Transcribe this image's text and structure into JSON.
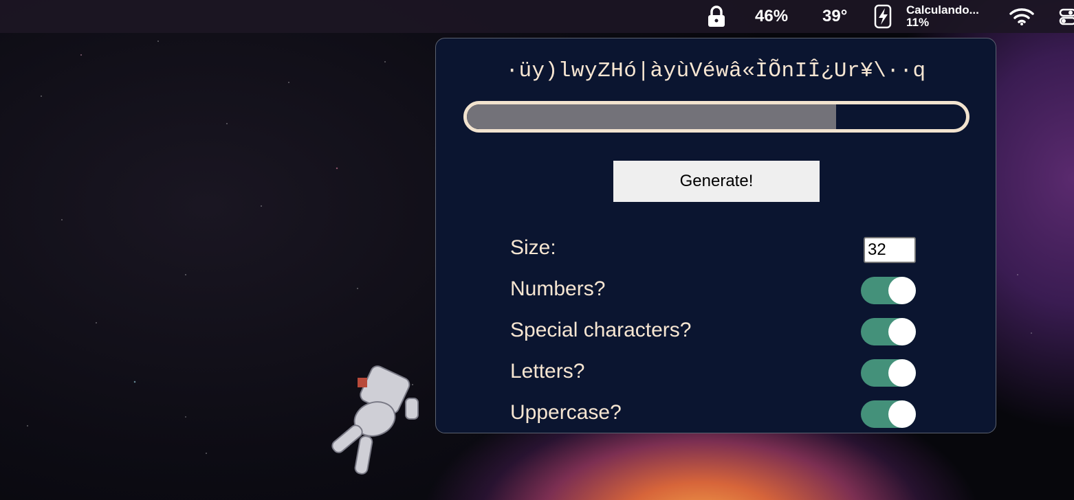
{
  "menubar": {
    "lock_icon": "lock-icon",
    "battery_percent": "46%",
    "temperature": "39°",
    "charging_icon": "battery-charging-icon",
    "status_line1": "Calculando...",
    "status_line2": "11%",
    "wifi_icon": "wifi-icon",
    "control_center_icon": "control-center-icon"
  },
  "generator": {
    "password": "·üy)lwyZHó|àyùVéwâ«ÌÕnIÎ¿Ur¥\\··q",
    "strength_fraction": 0.74,
    "generate_label": "Generate!",
    "options": {
      "size_label": "Size:",
      "size_value": "32",
      "numbers_label": "Numbers?",
      "numbers_on": true,
      "special_label": "Special characters?",
      "special_on": true,
      "letters_label": "Letters?",
      "letters_on": true,
      "uppercase_label": "Uppercase?",
      "uppercase_on": true
    }
  },
  "colors": {
    "panel_bg": "#0b1530",
    "text": "#f7e6d2",
    "toggle_on": "#44917a",
    "strength_fill": "#737279"
  }
}
